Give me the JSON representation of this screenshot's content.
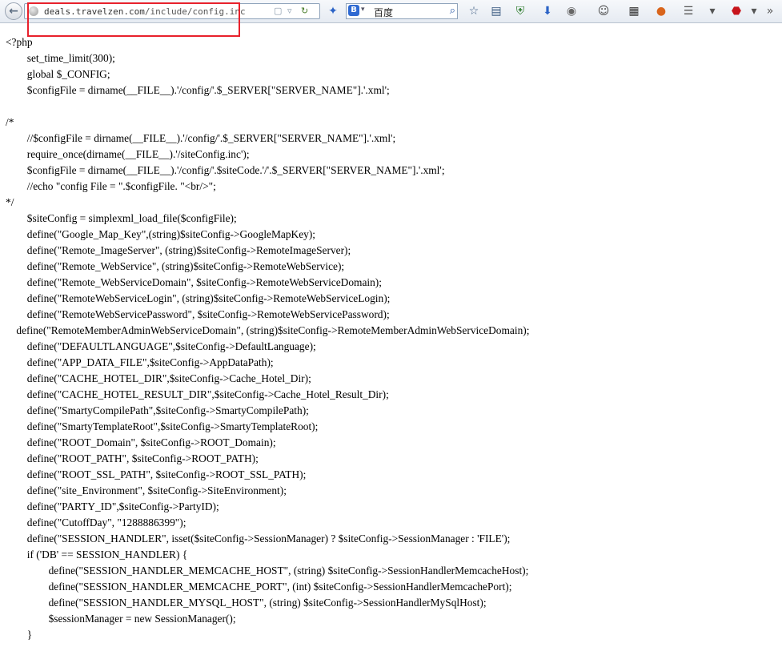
{
  "browser": {
    "url_domain": "deals.travelzen.com",
    "url_path": "/include/config.inc",
    "search_engine_label": "百度",
    "search_go_icon": "search-icon",
    "icons": [
      "back-arrow-icon",
      "site-icon",
      "bookmark-star-icon",
      "reader-icon",
      "shield-icon",
      "download-icon",
      "addon-icon",
      "palette-icon",
      "qr-icon",
      "firefox-icon",
      "menu-icon",
      "adblock-icon"
    ]
  },
  "code_lines": [
    "<?php",
    "        set_time_limit(300);",
    "        global $_CONFIG;",
    "        $configFile = dirname(__FILE__).'/config/'.$_SERVER[\"SERVER_NAME\"].'.xml';",
    "",
    "/*",
    "        //$configFile = dirname(__FILE__).'/config/'.$_SERVER[\"SERVER_NAME\"].'.xml';",
    "        require_once(dirname(__FILE__).'/siteConfig.inc');",
    "        $configFile = dirname(__FILE__).'/config/'.$siteCode.'/'.$_SERVER[\"SERVER_NAME\"].'.xml';",
    "        //echo \"config File = \".$configFile. \"<br/>\";",
    "*/",
    "        $siteConfig = simplexml_load_file($configFile);",
    "        define(\"Google_Map_Key\",(string)$siteConfig->GoogleMapKey);",
    "        define(\"Remote_ImageServer\", (string)$siteConfig->RemoteImageServer);",
    "        define(\"Remote_WebService\", (string)$siteConfig->RemoteWebService);",
    "        define(\"Remote_WebServiceDomain\", $siteConfig->RemoteWebServiceDomain);",
    "        define(\"RemoteWebServiceLogin\", (string)$siteConfig->RemoteWebServiceLogin);",
    "        define(\"RemoteWebServicePassword\", $siteConfig->RemoteWebServicePassword);",
    "    define(\"RemoteMemberAdminWebServiceDomain\", (string)$siteConfig->RemoteMemberAdminWebServiceDomain);",
    "        define(\"DEFAULTLANGUAGE\",$siteConfig->DefaultLanguage);",
    "        define(\"APP_DATA_FILE\",$siteConfig->AppDataPath);",
    "        define(\"CACHE_HOTEL_DIR\",$siteConfig->Cache_Hotel_Dir);",
    "        define(\"CACHE_HOTEL_RESULT_DIR\",$siteConfig->Cache_Hotel_Result_Dir);",
    "        define(\"SmartyCompilePath\",$siteConfig->SmartyCompilePath);",
    "        define(\"SmartyTemplateRoot\",$siteConfig->SmartyTemplateRoot);",
    "        define(\"ROOT_Domain\", $siteConfig->ROOT_Domain);",
    "        define(\"ROOT_PATH\", $siteConfig->ROOT_PATH);",
    "        define(\"ROOT_SSL_PATH\", $siteConfig->ROOT_SSL_PATH);",
    "        define(\"site_Environment\", $siteConfig->SiteEnvironment);",
    "        define(\"PARTY_ID\",$siteConfig->PartyID);",
    "        define(\"CutoffDay\", \"1288886399\");",
    "        define(\"SESSION_HANDLER\", isset($siteConfig->SessionManager) ? $siteConfig->SessionManager : 'FILE');",
    "        if ('DB' == SESSION_HANDLER) {",
    "                define(\"SESSION_HANDLER_MEMCACHE_HOST\", (string) $siteConfig->SessionHandlerMemcacheHost);",
    "                define(\"SESSION_HANDLER_MEMCACHE_PORT\", (int) $siteConfig->SessionHandlerMemcachePort);",
    "                define(\"SESSION_HANDLER_MYSQL_HOST\", (string) $siteConfig->SessionHandlerMySqlHost);",
    "                $sessionManager = new SessionManager();",
    "        }"
  ]
}
